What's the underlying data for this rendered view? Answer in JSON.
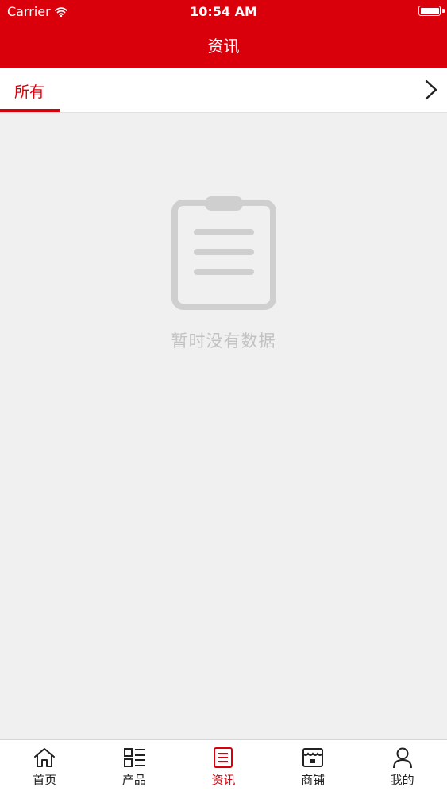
{
  "status_bar": {
    "carrier": "Carrier",
    "time": "10:54 AM"
  },
  "header": {
    "title": "资讯"
  },
  "tabs": {
    "items": [
      {
        "label": "所有",
        "active": true
      }
    ],
    "more_icon": "chevron-right-icon"
  },
  "empty_state": {
    "icon": "clipboard-icon",
    "message": "暂时没有数据"
  },
  "bottom_nav": {
    "items": [
      {
        "label": "首页",
        "icon": "home-icon",
        "active": false
      },
      {
        "label": "产品",
        "icon": "grid-list-icon",
        "active": false
      },
      {
        "label": "资讯",
        "icon": "news-icon",
        "active": true
      },
      {
        "label": "商铺",
        "icon": "shop-icon",
        "active": false
      },
      {
        "label": "我的",
        "icon": "user-icon",
        "active": false
      }
    ]
  },
  "colors": {
    "brand": "#d9000c",
    "background": "#f0f0f0",
    "empty_text": "#c2c2c2"
  }
}
